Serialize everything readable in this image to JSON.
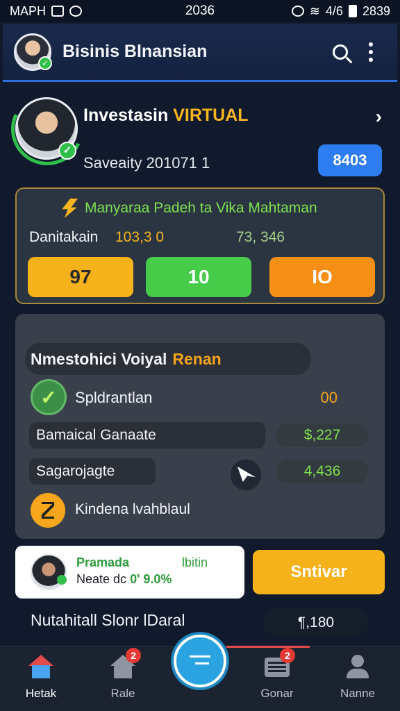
{
  "status_bar": {
    "carrier": "MAPH",
    "time": "2036",
    "battery": "4/6",
    "right_text": "2839"
  },
  "app_bar": {
    "title": "Bisinis Blnansian",
    "search_icon": "search-icon",
    "more_icon": "more-vert-icon"
  },
  "profile": {
    "name_part1": "Investasin",
    "name_part2": "VIRTUAL",
    "subtitle": "Saveaity 201071 1",
    "badge": "8403",
    "accent_color": "#f6b51e"
  },
  "promo": {
    "title": "Manyaraa Padeh ta Vika Mahtaman",
    "label": "Danitakain",
    "value1": "103,3 0",
    "value2": "73, 346",
    "buttons": [
      "97",
      "10",
      "IO"
    ],
    "border_color": "#a8893c"
  },
  "panel": {
    "header_main": "Nmestohici Voiyal",
    "header_accent": "Renan",
    "row1_label": "Spldrantlan",
    "row1_value": "00",
    "row2_label": "Bamaical Ganaate",
    "row2_value": "$,227",
    "row3_label": "Sagarojagte",
    "row3_value": "4,436",
    "row4_label": "Kindena lvahblaul"
  },
  "bottom_card": {
    "title": "Pramada",
    "tag": "lbitin",
    "line_text": "Neate dc",
    "line_value": "0' 9.0%"
  },
  "primary_button": "Sntivar",
  "summary": {
    "label": "Nutahitall Slonr lDaral",
    "value": "¶,180"
  },
  "tabs": [
    {
      "label": "Hetak",
      "icon": "home-icon",
      "active": true
    },
    {
      "label": "Rale",
      "icon": "home-icon",
      "badge": "2"
    },
    {
      "label": "Gonar",
      "icon": "tray-icon",
      "badge": "2"
    },
    {
      "label": "Nanne",
      "icon": "person-icon"
    }
  ]
}
